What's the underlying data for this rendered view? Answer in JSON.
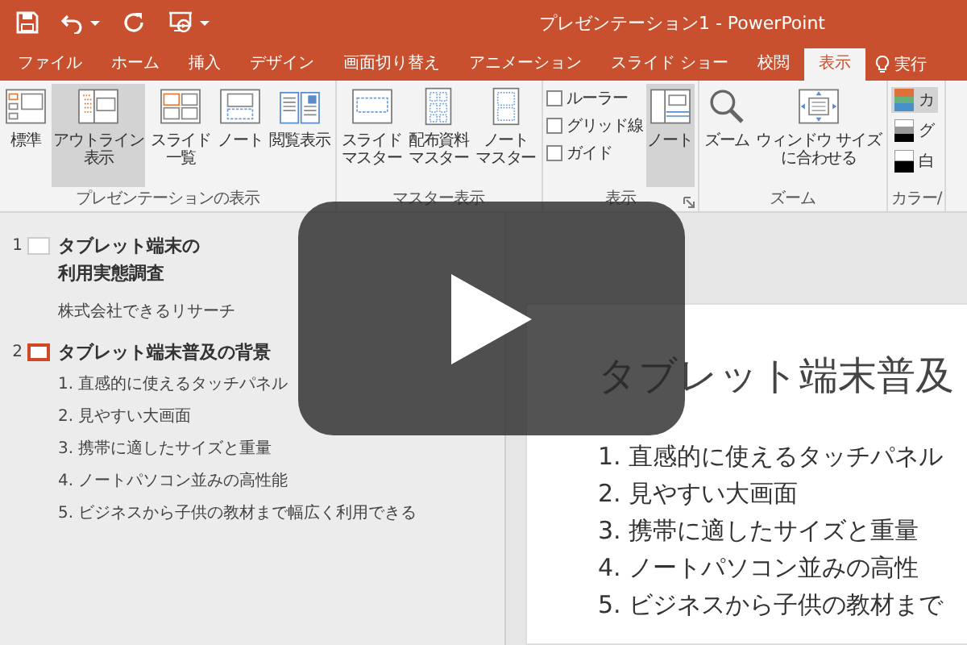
{
  "window": {
    "title": "プレゼンテーション1 - PowerPoint"
  },
  "tabs": [
    {
      "label": "ファイル",
      "selected": false
    },
    {
      "label": "ホーム",
      "selected": false
    },
    {
      "label": "挿入",
      "selected": false
    },
    {
      "label": "デザイン",
      "selected": false
    },
    {
      "label": "画面切り替え",
      "selected": false
    },
    {
      "label": "アニメーション",
      "selected": false
    },
    {
      "label": "スライド ショー",
      "selected": false
    },
    {
      "label": "校閲",
      "selected": false
    },
    {
      "label": "表示",
      "selected": true
    }
  ],
  "tell_me": {
    "label": "実行"
  },
  "ribbon_groups": [
    {
      "label": "プレゼンテーションの表示",
      "items": [
        {
          "kind": "large",
          "label": [
            "標準"
          ],
          "selected": false
        },
        {
          "kind": "large",
          "label": [
            "アウトライン",
            "表示"
          ],
          "selected": true
        },
        {
          "kind": "large",
          "label": [
            "スライド",
            "一覧"
          ],
          "selected": false
        },
        {
          "kind": "large",
          "label": [
            "ノート"
          ],
          "selected": false
        },
        {
          "kind": "large",
          "label": [
            "閲覧表示"
          ],
          "selected": false
        }
      ]
    },
    {
      "label": "マスター表示",
      "items": [
        {
          "kind": "large",
          "label": [
            "スライド",
            "マスター"
          ],
          "selected": false
        },
        {
          "kind": "large",
          "label": [
            "配布資料",
            "マスター"
          ],
          "selected": false
        },
        {
          "kind": "large",
          "label": [
            "ノート",
            "マスター"
          ],
          "selected": false
        }
      ]
    },
    {
      "label": "表示",
      "launcher": true,
      "items": [
        {
          "kind": "check",
          "label": "ルーラー",
          "checked": false
        },
        {
          "kind": "check",
          "label": "グリッド線",
          "checked": false
        },
        {
          "kind": "check",
          "label": "ガイド",
          "checked": false
        },
        {
          "kind": "large",
          "label": [
            "ノート"
          ],
          "selected": true
        }
      ]
    },
    {
      "label": "ズーム",
      "items": [
        {
          "kind": "large",
          "label": [
            "ズーム"
          ],
          "selected": false
        },
        {
          "kind": "large",
          "label": [
            "ウィンドウ サイズ",
            "に合わせる"
          ],
          "selected": false
        }
      ]
    },
    {
      "label": "カラー/",
      "items": [
        {
          "kind": "color",
          "label": "カ",
          "selected": true
        },
        {
          "kind": "gray",
          "label": "グ",
          "selected": false
        },
        {
          "kind": "bw",
          "label": "白",
          "selected": false
        }
      ]
    }
  ],
  "outline": [
    {
      "number": "1",
      "selected": false,
      "title_lines": [
        "タブレット端末の",
        "利用実態調査"
      ],
      "subtitle": "株式会社できるリサーチ"
    },
    {
      "number": "2",
      "selected": true,
      "title_lines": [
        "タブレット端末普及の背景"
      ],
      "bullets": [
        "1. 直感的に使えるタッチパネル",
        "2. 見やすい大画面",
        "3. 携帯に適したサイズと重量",
        "4. ノートパソコン並みの高性能",
        "5. ビジネスから子供の教材まで幅広く利用できる"
      ]
    }
  ],
  "slide": {
    "title": "タブレット端末普及",
    "bullets": [
      "1. 直感的に使えるタッチパネル",
      "2. 見やすい大画面",
      "3. 携帯に適したサイズと重量",
      "4. ノートパソコン並みの高性",
      "5. ビジネスから子供の教材まで"
    ]
  }
}
